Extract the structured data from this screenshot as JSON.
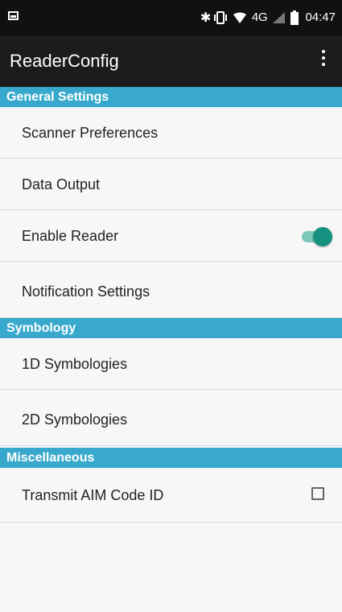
{
  "status_bar": {
    "network": "4G",
    "time": "04:47",
    "icons": [
      "screenshot-icon",
      "bluetooth-icon",
      "vibrate-icon",
      "wifi-icon",
      "signal-icon",
      "battery-icon"
    ]
  },
  "app_bar": {
    "title": "ReaderConfig",
    "menu_icon": "overflow-menu-icon"
  },
  "sections": [
    {
      "title": "General Settings",
      "items": [
        {
          "label": "Scanner Preferences"
        },
        {
          "label": "Data Output"
        },
        {
          "label": "Enable Reader",
          "control": "toggle",
          "checked": true
        },
        {
          "label": "Notification Settings"
        }
      ]
    },
    {
      "title": "Symbology",
      "items": [
        {
          "label": "1D Symbologies"
        },
        {
          "label": "2D Symbologies"
        }
      ]
    },
    {
      "title": "Miscellaneous",
      "items": [
        {
          "label": "Transmit AIM Code ID",
          "control": "checkbox",
          "checked": false
        }
      ]
    }
  ],
  "colors": {
    "section_header": "#38a9cc",
    "toggle_on": "#14927f",
    "app_bar": "#1c1c1c",
    "status_bar": "#111111"
  }
}
